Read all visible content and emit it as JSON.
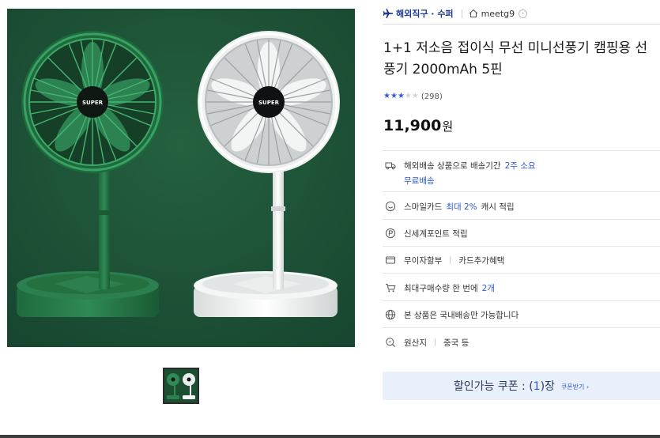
{
  "header": {
    "shipping_type": "해외직구 · 수퍼",
    "seller_name": "meetg9"
  },
  "product": {
    "title": "1+1 저소음 접이식 무선 미니선풍기 캠핑용 선풍기 2000mAh 5핀",
    "rating": 3,
    "rating_max": 5,
    "review_count": "(298)",
    "price_value": "11,900",
    "price_unit": "원",
    "image_badge_text": "SUPER"
  },
  "info_rows": {
    "shipping": {
      "label": "해외배송 상품으로 배송기간",
      "period": "2주 소요",
      "free": "무료배송"
    },
    "smile": {
      "prefix": "스마일카드",
      "highlight": "최대 2%",
      "suffix": "캐시 적립"
    },
    "shinsegae": {
      "label": "신세계포인트 적립"
    },
    "installment": {
      "label": "무이자할부",
      "extra": "카드추가혜택"
    },
    "max_purchase": {
      "label": "최대구매수량 한 번에",
      "count": "2개"
    },
    "domestic": {
      "label": "본 상품은 국내배송만 가능합니다"
    },
    "origin": {
      "label": "원산지",
      "value": "중국 등"
    }
  },
  "coupon": {
    "prefix": "할인가능 쿠폰 : (",
    "count": "1",
    "suffix": ")장",
    "link": "쿠폰받기 ›"
  },
  "colors": {
    "accent_blue": "#2d5ad8",
    "image_bg": "#1c4e32",
    "coupon_bg": "#eaf0fb"
  },
  "icons": {
    "shipping_type": "airplane-icon",
    "seller": "home-icon",
    "shipping": "truck-icon",
    "smile": "smile-icon",
    "shinsegae": "point-circle-icon",
    "installment": "card-icon",
    "max_purchase": "cart-icon",
    "domestic": "globe-icon",
    "origin": "search-icon"
  }
}
